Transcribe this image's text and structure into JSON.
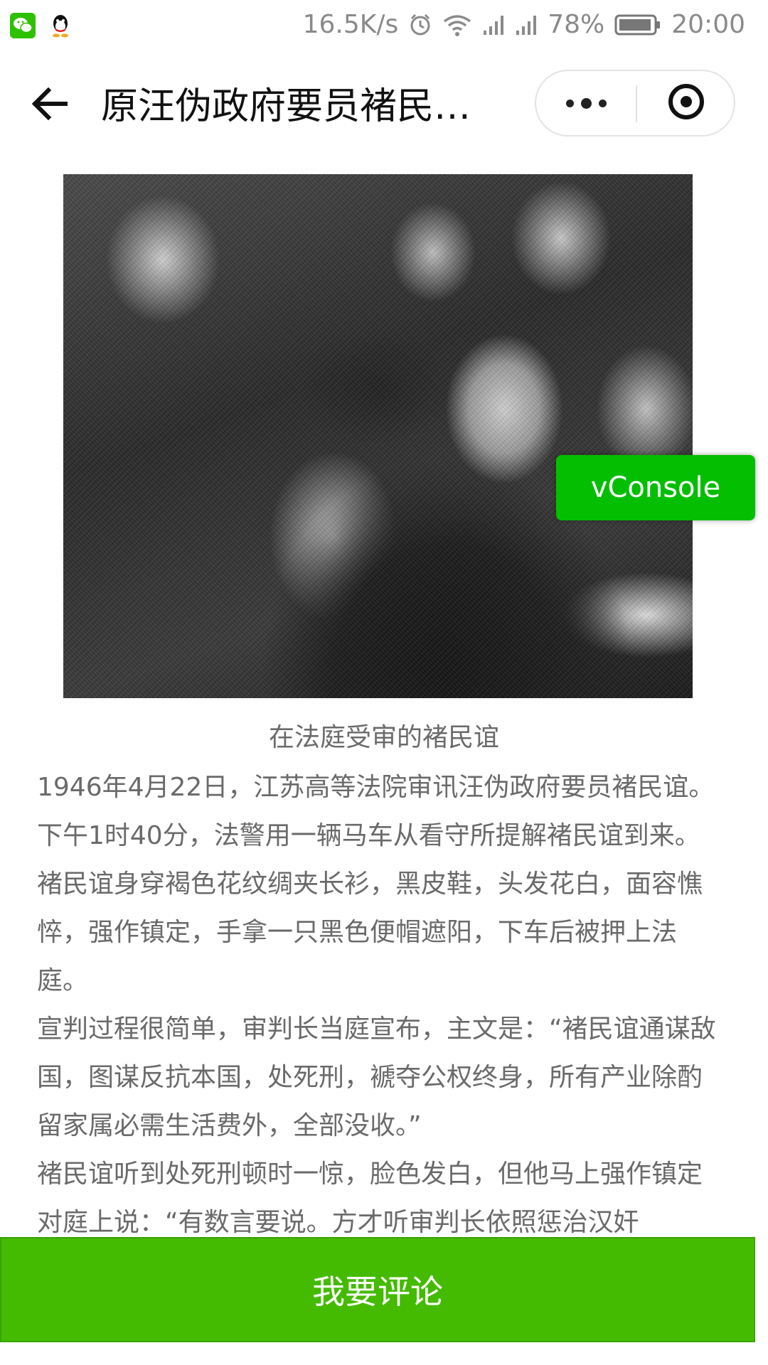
{
  "status_bar": {
    "net_speed": "16.5K/s",
    "battery_percent": "78%",
    "time": "20:00",
    "icons": [
      "wechat-icon",
      "qq-icon",
      "alarm-icon",
      "wifi-icon",
      "signal-icon",
      "battery-icon"
    ]
  },
  "nav": {
    "title": "原汪伪政府要员褚民…",
    "back_icon": "back-arrow-icon",
    "more_icon": "more-dots-icon",
    "close_icon": "target-close-icon"
  },
  "article": {
    "caption": "在法庭受审的褚民谊",
    "paragraphs": [
      "1946年4月22日，江苏高等法院审讯汪伪政府要员褚民谊。下午1时40分，法警用一辆马车从看守所提解褚民谊到来。褚民谊身穿褐色花纹绸夹长衫，黑皮鞋，头发花白，面容憔悴，强作镇定，手拿一只黑色便帽遮阳，下车后被押上法庭。",
      "宣判过程很简单，审判长当庭宣布，主文是：“褚民谊通谋敌国，图谋反抗本国，处死刑，褫夺公权终身，所有产业除酌留家属必需生活费外，全部没收。”",
      "褚民谊听到处死刑顿时一惊，脸色发白，但他马上强作镇定对庭上说：“有数言要说。方才听审判长依照惩治汉奸"
    ]
  },
  "vconsole": {
    "label": "vConsole"
  },
  "comment_button": {
    "label": "我要评论"
  },
  "colors": {
    "accent_green": "#44bb00",
    "vconsole_green": "#04be02",
    "body_text": "#6a6a6a"
  }
}
